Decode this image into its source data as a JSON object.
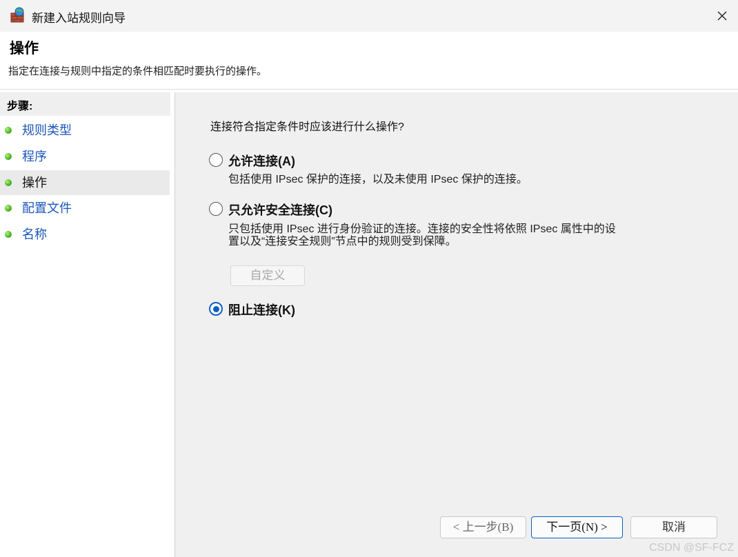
{
  "window": {
    "title": "新建入站规则向导",
    "icons": {
      "app": "firewall-icon",
      "close": "close-icon"
    }
  },
  "header": {
    "title": "操作",
    "description": "指定在连接与规则中指定的条件相匹配时要执行的操作。"
  },
  "sidebar": {
    "steps_label": "步骤:",
    "steps": [
      {
        "label": "规则类型",
        "active": false
      },
      {
        "label": "程序",
        "active": false
      },
      {
        "label": "操作",
        "active": true
      },
      {
        "label": "配置文件",
        "active": false
      },
      {
        "label": "名称",
        "active": false
      }
    ]
  },
  "main": {
    "question": "连接符合指定条件时应该进行什么操作?",
    "options": [
      {
        "label": "允许连接(A)",
        "description": "包括使用 IPsec 保护的连接，以及未使用 IPsec 保护的连接。",
        "checked": false
      },
      {
        "label": "只允许安全连接(C)",
        "description_line1": "只包括使用 IPsec 进行身份验证的连接。连接的安全性将依照 IPsec 属性中的设",
        "description_line2": "置以及“连接安全规则”节点中的规则受到保障。",
        "checked": false
      },
      {
        "label": "阻止连接(K)",
        "checked": true
      }
    ],
    "custom_button": "自定义"
  },
  "footer": {
    "back": "< 上一步(B)",
    "next": "下一页(N) >",
    "cancel": "取消"
  },
  "watermark": "CSDN @SF-FCZ",
  "colors": {
    "accent": "#0a5fc2",
    "link": "#1a56b8",
    "step_dot": "#4cb820"
  }
}
